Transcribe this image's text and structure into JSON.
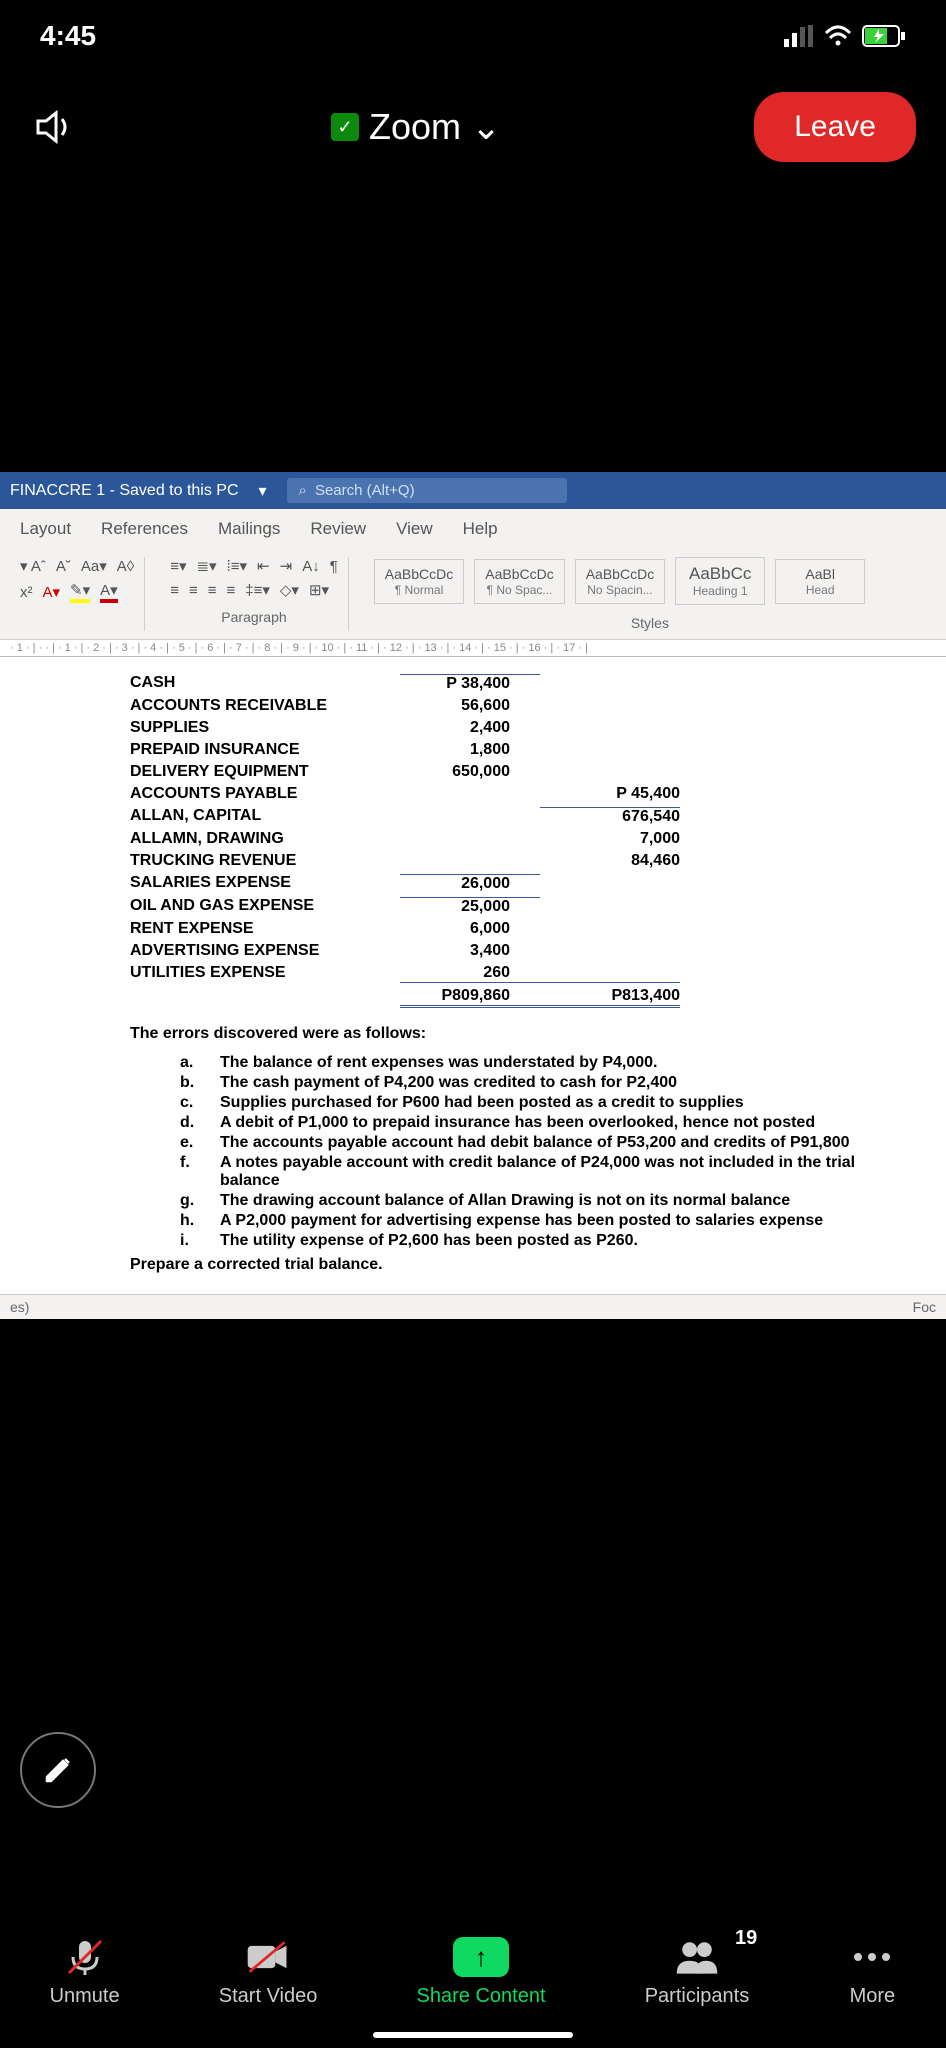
{
  "status": {
    "time": "4:45"
  },
  "zoom": {
    "title": "Zoom",
    "leave": "Leave"
  },
  "word": {
    "doc_title": "FINACCRE 1 - Saved to this PC",
    "search_placeholder": "Search (Alt+Q)",
    "tabs": [
      "Layout",
      "References",
      "Mailings",
      "Review",
      "View",
      "Help"
    ],
    "group_paragraph": "Paragraph",
    "group_styles": "Styles",
    "styles": [
      {
        "sample": "AaBbCcDc",
        "name": "¶ Normal"
      },
      {
        "sample": "AaBbCcDc",
        "name": "¶ No Spac..."
      },
      {
        "sample": "AaBbCcDc",
        "name": "No Spacin..."
      },
      {
        "sample": "AaBbCc",
        "name": "Heading 1"
      },
      {
        "sample": "AaBl",
        "name": "Head"
      }
    ],
    "ruler": "· 1 · | ·   · | · 1 · | · 2 · | · 3 · | · 4 · | · 5 · | · 6 · | · 7 · | · 8 · | · 9 · | · 10 · | · 11 · | · 12 · | · 13 · | · 14 · | · 15 · | · 16 · | · 17 · |",
    "status_left": "es)",
    "status_right": "Foc"
  },
  "trial_balance": {
    "rows": [
      {
        "name": "CASH",
        "debit": "P 38,400",
        "credit": ""
      },
      {
        "name": "ACCOUNTS RECEIVABLE",
        "debit": "56,600",
        "credit": ""
      },
      {
        "name": "SUPPLIES",
        "debit": "2,400",
        "credit": ""
      },
      {
        "name": "PREPAID INSURANCE",
        "debit": "1,800",
        "credit": ""
      },
      {
        "name": "DELIVERY EQUIPMENT",
        "debit": "650,000",
        "credit": ""
      },
      {
        "name": "ACCOUNTS PAYABLE",
        "debit": "",
        "credit": "P 45,400"
      },
      {
        "name": "ALLAN, CAPITAL",
        "debit": "",
        "credit": "676,540"
      },
      {
        "name": "ALLAMN, DRAWING",
        "debit": "",
        "credit": "7,000"
      },
      {
        "name": "TRUCKING REVENUE",
        "debit": "",
        "credit": "84,460"
      },
      {
        "name": "SALARIES EXPENSE",
        "debit": "26,000",
        "credit": ""
      },
      {
        "name": "OIL AND GAS EXPENSE",
        "debit": "25,000",
        "credit": ""
      },
      {
        "name": "RENT EXPENSE",
        "debit": "6,000",
        "credit": ""
      },
      {
        "name": "ADVERTISING EXPENSE",
        "debit": "3,400",
        "credit": ""
      },
      {
        "name": "UTILITIES EXPENSE",
        "debit": "260",
        "credit": ""
      }
    ],
    "total_debit": "P809,860",
    "total_credit": "P813,400"
  },
  "errors": {
    "heading": "The errors discovered were as follows:",
    "items": [
      {
        "l": "a.",
        "t": "The balance of rent expenses was understated by P4,000."
      },
      {
        "l": "b.",
        "t": "The cash payment of P4,200 was credited to cash for P2,400"
      },
      {
        "l": "c.",
        "t": "Supplies purchased for P600 had been posted as a credit to supplies"
      },
      {
        "l": "d.",
        "t": "A debit of P1,000 to prepaid insurance has been overlooked, hence not posted"
      },
      {
        "l": "e.",
        "t": "The accounts payable account had debit balance of P53,200 and credits of P91,800"
      },
      {
        "l": "f.",
        "t": "A notes payable account with credit balance of P24,000 was not included in the trial balance"
      },
      {
        "l": "g.",
        "t": "The drawing account balance of Allan Drawing is not on its normal balance"
      },
      {
        "l": "h.",
        "t": "A P2,000 payment for advertising expense has been posted to salaries expense"
      },
      {
        "l": "i.",
        "t": "The utility expense of P2,600 has been posted as P260."
      }
    ],
    "prepare": "Prepare a corrected trial balance."
  },
  "bottom": {
    "unmute": "Unmute",
    "start_video": "Start Video",
    "share": "Share Content",
    "participants": "Participants",
    "participants_count": "19",
    "more": "More"
  }
}
